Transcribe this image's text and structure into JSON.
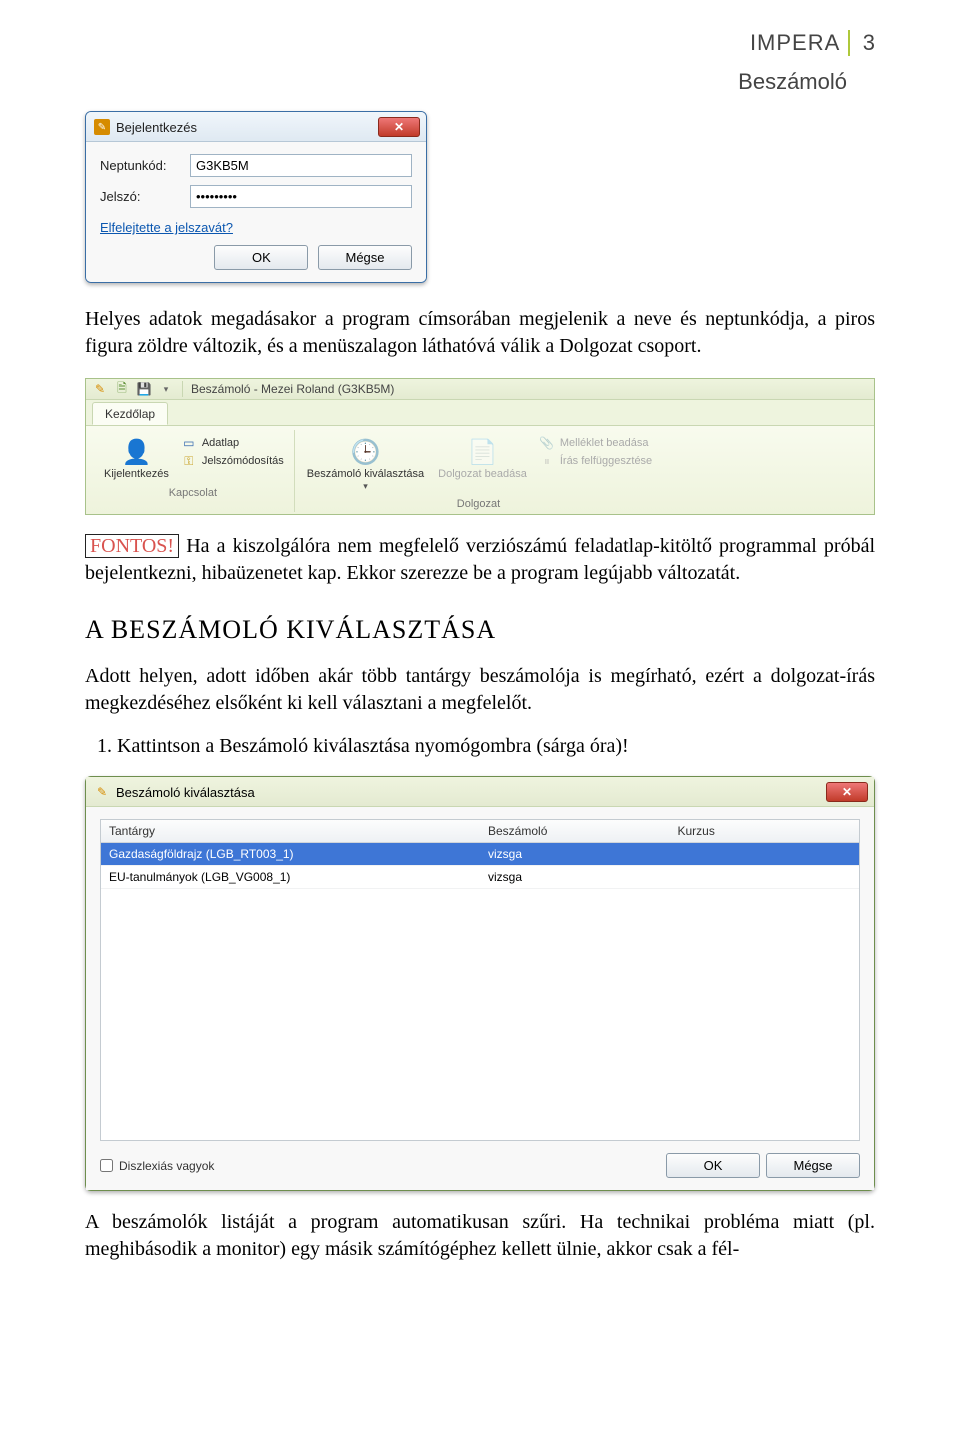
{
  "header": {
    "brand": "IMPERA",
    "subtitle": "Beszámoló",
    "page_number": "3"
  },
  "login_dialog": {
    "title": "Bejelentkezés",
    "fields": {
      "neptun_label": "Neptunkód:",
      "neptun_value": "G3KB5M",
      "password_label": "Jelszó:",
      "password_value": "•••••••••"
    },
    "forgot_link": "Elfelejtette a jelszavát?",
    "ok": "OK",
    "cancel": "Mégse"
  },
  "para1": "Helyes adatok megadásakor a program címsorában megjelenik a neve és neptunkódja, a piros figura zöldre változik, és a menüszalagon láthatóvá válik a Dolgozat csoport.",
  "ribbon": {
    "app_title": "Beszámoló - Mezei Roland (G3KB5M)",
    "tab": "Kezdőlap",
    "groups": {
      "kapcsolat": {
        "name": "Kapcsolat",
        "kijelentkezes": "Kijelentkezés",
        "adatlap": "Adatlap",
        "jelszomod": "Jelszómódosítás"
      },
      "dolgozat": {
        "name": "Dolgozat",
        "kivalasztas": "Beszámoló kiválasztása",
        "beadas": "Dolgozat beadása",
        "melleklet": "Melléklet beadása",
        "felfugg": "Írás felfüggesztése"
      }
    }
  },
  "fontos_label": "FONTOS!",
  "para2": "Ha a kiszolgálóra nem megfelelő verziószámú feladatlap-kitöltő programmal próbál bejelentkezni, hibaüzenetet kap. Ekkor szerezze be a program legújabb változatát.",
  "section_title": "A BESZÁMOLÓ KIVÁLASZTÁSA",
  "para3": "Adott helyen, adott időben akár több tantárgy beszámolója is megírható, ezért a dolgozat-írás megkezdéséhez elsőként ki kell választani a megfelelőt.",
  "step1": "Kattintson a Beszámoló kiválasztása nyomógombra (sárga óra)!",
  "selection_dialog": {
    "title": "Beszámoló kiválasztása",
    "columns": {
      "tantargy": "Tantárgy",
      "beszamolo": "Beszámoló",
      "kurzus": "Kurzus"
    },
    "rows": [
      {
        "tantargy": "Gazdaságföldrajz (LGB_RT003_1)",
        "beszamolo": "vizsga",
        "kurzus": ""
      },
      {
        "tantargy": "EU-tanulmányok (LGB_VG008_1)",
        "beszamolo": "vizsga",
        "kurzus": ""
      }
    ],
    "dyslexia_label": "Diszlexiás vagyok",
    "ok": "OK",
    "cancel": "Mégse"
  },
  "para4": "A beszámolók listáját a program automatikusan szűri. Ha technikai probléma miatt (pl. meghibásodik a monitor) egy másik számítógéphez kellett ülnie, akkor csak a fél-"
}
